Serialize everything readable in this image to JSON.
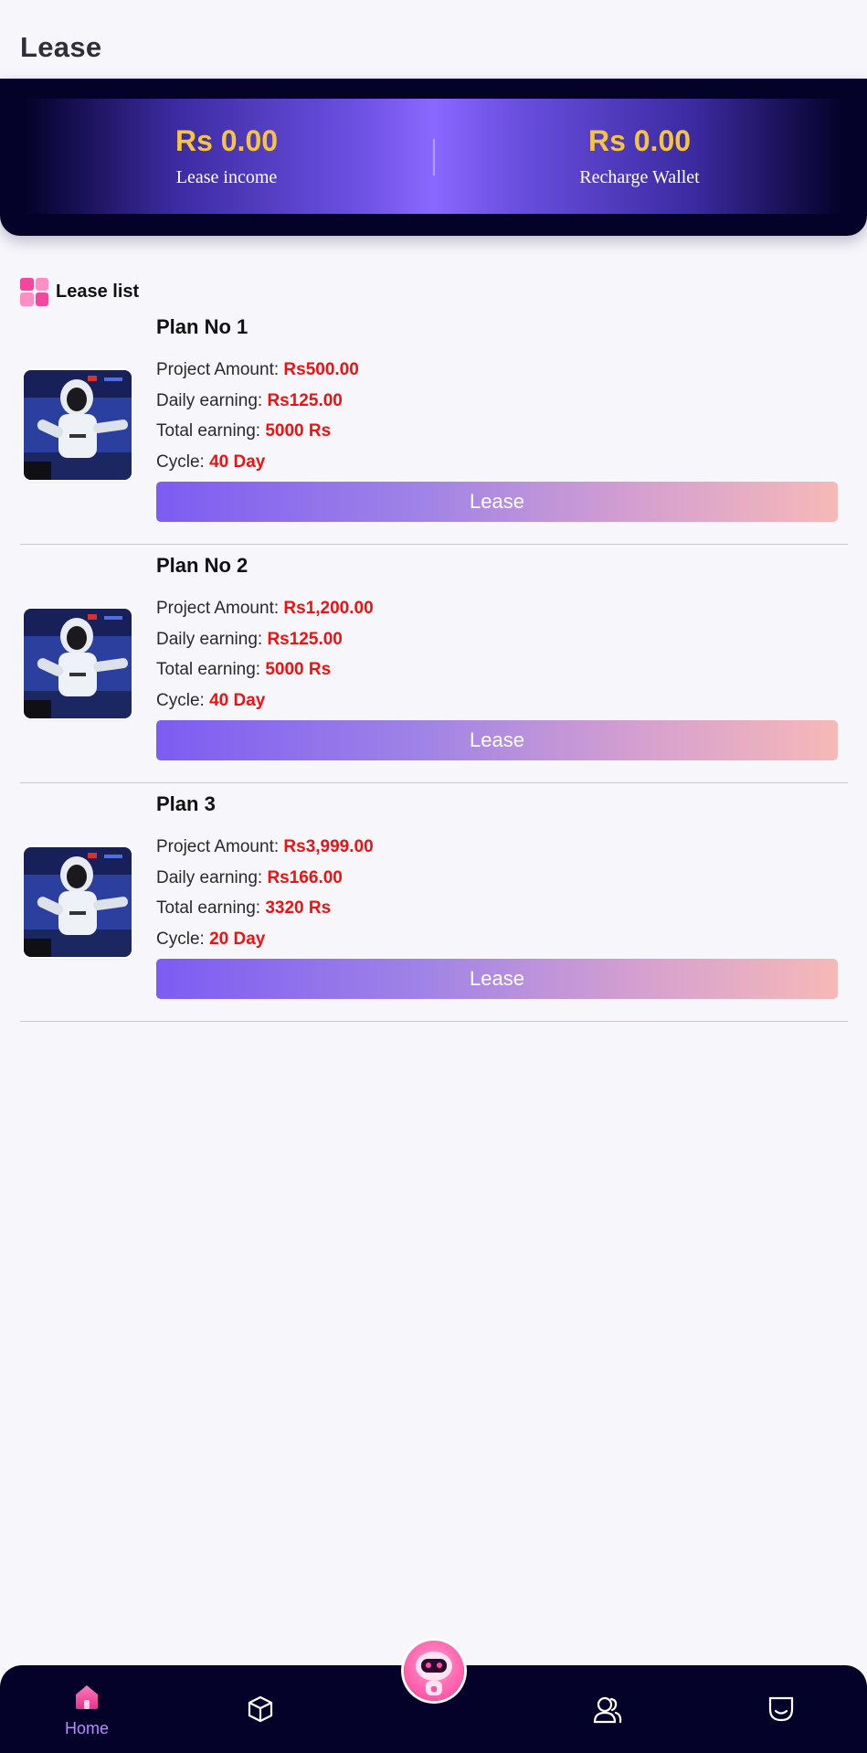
{
  "header": {
    "title": "Lease"
  },
  "banner": {
    "left": {
      "value": "Rs 0.00",
      "label": "Lease income"
    },
    "right": {
      "value": "Rs 0.00",
      "label": "Recharge Wallet"
    }
  },
  "section": {
    "title": "Lease list"
  },
  "plans": [
    {
      "name": "Plan No 1",
      "amount_label": "Project Amount: ",
      "amount": "Rs500.00",
      "daily_label": "Daily earning: ",
      "daily": "Rs125.00",
      "total_label": "Total earning: ",
      "total": "5000 Rs",
      "cycle_label": "Cycle: ",
      "cycle": "40 Day",
      "button": "Lease"
    },
    {
      "name": "Plan No 2",
      "amount_label": "Project Amount: ",
      "amount": "Rs1,200.00",
      "daily_label": "Daily earning: ",
      "daily": "Rs125.00",
      "total_label": "Total earning: ",
      "total": "5000 Rs",
      "cycle_label": "Cycle: ",
      "cycle": "40 Day",
      "button": "Lease"
    },
    {
      "name": "Plan 3",
      "amount_label": "Project Amount: ",
      "amount": "Rs3,999.00",
      "daily_label": "Daily earning: ",
      "daily": "Rs166.00",
      "total_label": "Total earning: ",
      "total": "3320 Rs",
      "cycle_label": "Cycle: ",
      "cycle": "20 Day",
      "button": "Lease"
    }
  ],
  "nav": {
    "home_label": "Home",
    "icons": [
      "home-icon",
      "box-icon",
      "robot-icon",
      "users-icon",
      "profile-icon"
    ]
  },
  "colors": {
    "accent_gold": "#f6c443",
    "value_red": "#ee1111",
    "nav_bg": "#05022a",
    "nav_active": "#b88dff",
    "button_gradient_start": "#7c5cf2",
    "button_gradient_end": "#f6b9b8"
  }
}
